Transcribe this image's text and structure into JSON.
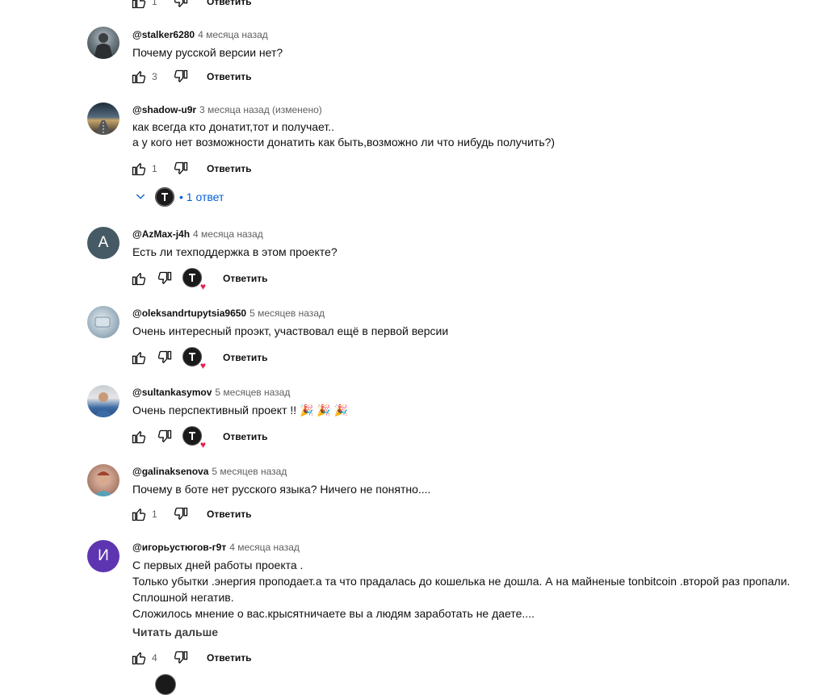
{
  "colors": {
    "link_blue": "#065fd4",
    "heart_red": "#e8214b",
    "muted": "#606060"
  },
  "top_actions": {
    "likes": "1",
    "reply": "Ответить"
  },
  "comments": [
    {
      "author": "@stalker6280",
      "time": "4 месяца назад",
      "lines": [
        "Почему русской версии нет?"
      ],
      "likes": "3",
      "reply": "Ответить",
      "avatar_letter": ""
    },
    {
      "author": "@shadow-u9r",
      "time": "3 месяца назад (изменено)",
      "lines": [
        "как всегда кто донатит,тот и получает..",
        "а у кого нет возможности донатить как быть,возможно ли что нибудь получить?)"
      ],
      "likes": "1",
      "reply": "Ответить",
      "replies_label": "• 1 ответ"
    },
    {
      "author": "@AzMax-j4h",
      "time": "4 месяца назад",
      "lines": [
        "Есть ли техподдержка в этом проекте?"
      ],
      "likes": "",
      "reply": "Ответить",
      "avatar_letter": "A"
    },
    {
      "author": "@oleksandrtupytsia9650",
      "time": "5 месяцев назад",
      "lines": [
        "Очень интересный проэкт, участвовал ещё в первой версии"
      ],
      "likes": "",
      "reply": "Ответить"
    },
    {
      "author": "@sultankasymov",
      "time": "5 месяцев назад",
      "lines": [
        "Очень перспективный проект !! 🎉 🎉 🎉"
      ],
      "likes": "",
      "reply": "Ответить"
    },
    {
      "author": "@galinaksenova",
      "time": "5 месяцев назад",
      "lines": [
        "Почему в боте нет русского языка? Ничего не понятно...."
      ],
      "likes": "1",
      "reply": "Ответить"
    },
    {
      "author": "@игорьустюгов-г9т",
      "time": "4 месяца назад",
      "lines": [
        "С первых дней работы проекта .",
        "Только убытки .энергия проподает.а та что прадалась до кошелька не дошла. А  на майненые  tonbitcoin .второй раз пропали.",
        "Сплошной негатив.",
        "Сложилось мнение о вас.крысятничаете вы а людям заработать не даете...."
      ],
      "likes": "4",
      "reply": "Ответить",
      "read_more": "Читать дальше",
      "avatar_letter": "И"
    }
  ]
}
